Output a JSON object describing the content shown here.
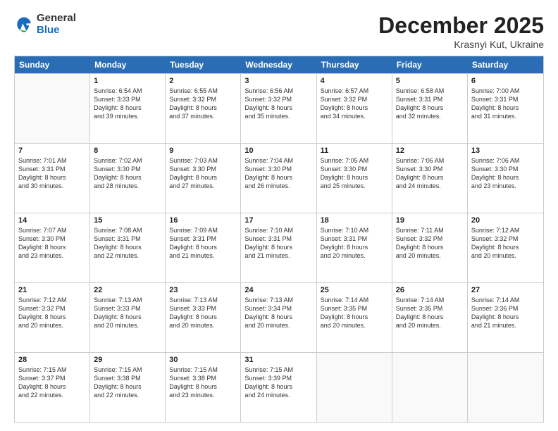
{
  "logo": {
    "general": "General",
    "blue": "Blue"
  },
  "header": {
    "month": "December 2025",
    "location": "Krasnyi Kut, Ukraine"
  },
  "days": [
    "Sunday",
    "Monday",
    "Tuesday",
    "Wednesday",
    "Thursday",
    "Friday",
    "Saturday"
  ],
  "weeks": [
    [
      {
        "day": "",
        "lines": []
      },
      {
        "day": "1",
        "lines": [
          "Sunrise: 6:54 AM",
          "Sunset: 3:33 PM",
          "Daylight: 8 hours",
          "and 39 minutes."
        ]
      },
      {
        "day": "2",
        "lines": [
          "Sunrise: 6:55 AM",
          "Sunset: 3:32 PM",
          "Daylight: 8 hours",
          "and 37 minutes."
        ]
      },
      {
        "day": "3",
        "lines": [
          "Sunrise: 6:56 AM",
          "Sunset: 3:32 PM",
          "Daylight: 8 hours",
          "and 35 minutes."
        ]
      },
      {
        "day": "4",
        "lines": [
          "Sunrise: 6:57 AM",
          "Sunset: 3:32 PM",
          "Daylight: 8 hours",
          "and 34 minutes."
        ]
      },
      {
        "day": "5",
        "lines": [
          "Sunrise: 6:58 AM",
          "Sunset: 3:31 PM",
          "Daylight: 8 hours",
          "and 32 minutes."
        ]
      },
      {
        "day": "6",
        "lines": [
          "Sunrise: 7:00 AM",
          "Sunset: 3:31 PM",
          "Daylight: 8 hours",
          "and 31 minutes."
        ]
      }
    ],
    [
      {
        "day": "7",
        "lines": [
          "Sunrise: 7:01 AM",
          "Sunset: 3:31 PM",
          "Daylight: 8 hours",
          "and 30 minutes."
        ]
      },
      {
        "day": "8",
        "lines": [
          "Sunrise: 7:02 AM",
          "Sunset: 3:30 PM",
          "Daylight: 8 hours",
          "and 28 minutes."
        ]
      },
      {
        "day": "9",
        "lines": [
          "Sunrise: 7:03 AM",
          "Sunset: 3:30 PM",
          "Daylight: 8 hours",
          "and 27 minutes."
        ]
      },
      {
        "day": "10",
        "lines": [
          "Sunrise: 7:04 AM",
          "Sunset: 3:30 PM",
          "Daylight: 8 hours",
          "and 26 minutes."
        ]
      },
      {
        "day": "11",
        "lines": [
          "Sunrise: 7:05 AM",
          "Sunset: 3:30 PM",
          "Daylight: 8 hours",
          "and 25 minutes."
        ]
      },
      {
        "day": "12",
        "lines": [
          "Sunrise: 7:06 AM",
          "Sunset: 3:30 PM",
          "Daylight: 8 hours",
          "and 24 minutes."
        ]
      },
      {
        "day": "13",
        "lines": [
          "Sunrise: 7:06 AM",
          "Sunset: 3:30 PM",
          "Daylight: 8 hours",
          "and 23 minutes."
        ]
      }
    ],
    [
      {
        "day": "14",
        "lines": [
          "Sunrise: 7:07 AM",
          "Sunset: 3:30 PM",
          "Daylight: 8 hours",
          "and 23 minutes."
        ]
      },
      {
        "day": "15",
        "lines": [
          "Sunrise: 7:08 AM",
          "Sunset: 3:31 PM",
          "Daylight: 8 hours",
          "and 22 minutes."
        ]
      },
      {
        "day": "16",
        "lines": [
          "Sunrise: 7:09 AM",
          "Sunset: 3:31 PM",
          "Daylight: 8 hours",
          "and 21 minutes."
        ]
      },
      {
        "day": "17",
        "lines": [
          "Sunrise: 7:10 AM",
          "Sunset: 3:31 PM",
          "Daylight: 8 hours",
          "and 21 minutes."
        ]
      },
      {
        "day": "18",
        "lines": [
          "Sunrise: 7:10 AM",
          "Sunset: 3:31 PM",
          "Daylight: 8 hours",
          "and 20 minutes."
        ]
      },
      {
        "day": "19",
        "lines": [
          "Sunrise: 7:11 AM",
          "Sunset: 3:32 PM",
          "Daylight: 8 hours",
          "and 20 minutes."
        ]
      },
      {
        "day": "20",
        "lines": [
          "Sunrise: 7:12 AM",
          "Sunset: 3:32 PM",
          "Daylight: 8 hours",
          "and 20 minutes."
        ]
      }
    ],
    [
      {
        "day": "21",
        "lines": [
          "Sunrise: 7:12 AM",
          "Sunset: 3:32 PM",
          "Daylight: 8 hours",
          "and 20 minutes."
        ]
      },
      {
        "day": "22",
        "lines": [
          "Sunrise: 7:13 AM",
          "Sunset: 3:33 PM",
          "Daylight: 8 hours",
          "and 20 minutes."
        ]
      },
      {
        "day": "23",
        "lines": [
          "Sunrise: 7:13 AM",
          "Sunset: 3:33 PM",
          "Daylight: 8 hours",
          "and 20 minutes."
        ]
      },
      {
        "day": "24",
        "lines": [
          "Sunrise: 7:13 AM",
          "Sunset: 3:34 PM",
          "Daylight: 8 hours",
          "and 20 minutes."
        ]
      },
      {
        "day": "25",
        "lines": [
          "Sunrise: 7:14 AM",
          "Sunset: 3:35 PM",
          "Daylight: 8 hours",
          "and 20 minutes."
        ]
      },
      {
        "day": "26",
        "lines": [
          "Sunrise: 7:14 AM",
          "Sunset: 3:35 PM",
          "Daylight: 8 hours",
          "and 20 minutes."
        ]
      },
      {
        "day": "27",
        "lines": [
          "Sunrise: 7:14 AM",
          "Sunset: 3:36 PM",
          "Daylight: 8 hours",
          "and 21 minutes."
        ]
      }
    ],
    [
      {
        "day": "28",
        "lines": [
          "Sunrise: 7:15 AM",
          "Sunset: 3:37 PM",
          "Daylight: 8 hours",
          "and 22 minutes."
        ]
      },
      {
        "day": "29",
        "lines": [
          "Sunrise: 7:15 AM",
          "Sunset: 3:38 PM",
          "Daylight: 8 hours",
          "and 22 minutes."
        ]
      },
      {
        "day": "30",
        "lines": [
          "Sunrise: 7:15 AM",
          "Sunset: 3:38 PM",
          "Daylight: 8 hours",
          "and 23 minutes."
        ]
      },
      {
        "day": "31",
        "lines": [
          "Sunrise: 7:15 AM",
          "Sunset: 3:39 PM",
          "Daylight: 8 hours",
          "and 24 minutes."
        ]
      },
      {
        "day": "",
        "lines": []
      },
      {
        "day": "",
        "lines": []
      },
      {
        "day": "",
        "lines": []
      }
    ]
  ]
}
